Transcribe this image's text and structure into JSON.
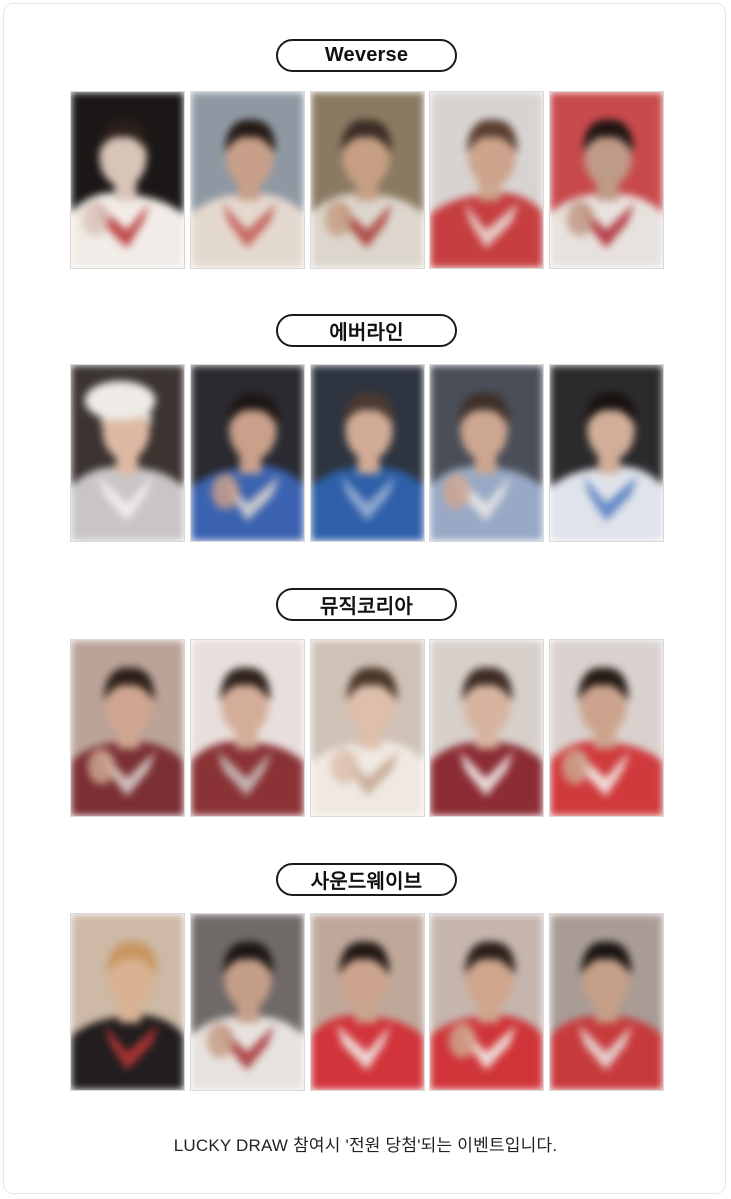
{
  "sections": [
    {
      "label": "Weverse",
      "cards": [
        {
          "bg": "#1a1716",
          "skin": "#d9c4b8",
          "top": "#f1ece7",
          "accent": "#b83a3c",
          "hair": "#2a1f1a",
          "hat": ""
        },
        {
          "bg": "#8f98a2",
          "skin": "#c8a08a",
          "top": "#e4d9cf",
          "accent": "#c15d55",
          "hair": "#231a16",
          "hat": ""
        },
        {
          "bg": "#8a7a62",
          "skin": "#c69f84",
          "top": "#dcd6cc",
          "accent": "#a8403c",
          "hair": "#3a2c24",
          "hat": ""
        },
        {
          "bg": "#d7d3d1",
          "skin": "#cda48c",
          "top": "#c63e40",
          "accent": "#ead9d4",
          "hair": "#5a3e30",
          "hat": ""
        },
        {
          "bg": "#c84a4c",
          "skin": "#bf9a86",
          "top": "#e8e2de",
          "accent": "#b0303a",
          "hair": "#1e1614",
          "hat": ""
        }
      ]
    },
    {
      "label": "에버라인",
      "cards": [
        {
          "bg": "#3b3430",
          "skin": "#ddb9a4",
          "top": "#c9c4c6",
          "accent": "#f2efec",
          "hair": "#e9e6e3",
          "hat": "#eeeae6"
        },
        {
          "bg": "#2a2a30",
          "skin": "#c9a08a",
          "top": "#3b62b0",
          "accent": "#d8d3d0",
          "hair": "#1d1714",
          "hat": ""
        },
        {
          "bg": "#2e3440",
          "skin": "#d1ab95",
          "top": "#2e5fa8",
          "accent": "#9ab0d4",
          "hair": "#4a3a32",
          "hat": ""
        },
        {
          "bg": "#4a4e58",
          "skin": "#cda690",
          "top": "#98a9c6",
          "accent": "#e9e6e6",
          "hair": "#3e3028",
          "hat": ""
        },
        {
          "bg": "#2b2a2c",
          "skin": "#d2ae98",
          "top": "#dfe3ea",
          "accent": "#5a7fc2",
          "hair": "#17120f",
          "hat": ""
        }
      ]
    },
    {
      "label": "뮤직코리아",
      "cards": [
        {
          "bg": "#bba398",
          "skin": "#cfa690",
          "top": "#7a2f34",
          "accent": "#d9cfcb",
          "hair": "#2a1e18",
          "hat": ""
        },
        {
          "bg": "#e8dedb",
          "skin": "#d3ad98",
          "top": "#8a3236",
          "accent": "#c9c0bd",
          "hair": "#2e221c",
          "hat": ""
        },
        {
          "bg": "#cfc1b6",
          "skin": "#ddbfac",
          "top": "#efe9e2",
          "accent": "#c7a893",
          "hair": "#4a3628",
          "hat": ""
        },
        {
          "bg": "#d7cfca",
          "skin": "#d6b4a0",
          "top": "#8c2c34",
          "accent": "#f1ede9",
          "hair": "#3c2b22",
          "hat": ""
        },
        {
          "bg": "#d9d1cd",
          "skin": "#cca48e",
          "top": "#d03a3c",
          "accent": "#f3eeea",
          "hair": "#241a15",
          "hat": ""
        }
      ]
    },
    {
      "label": "사운드웨이브",
      "cards": [
        {
          "bg": "#cdb9a6",
          "skin": "#d8b293",
          "top": "#221d1e",
          "accent": "#b73636",
          "hair": "#c89660",
          "hat": ""
        },
        {
          "bg": "#6f6a68",
          "skin": "#c59e89",
          "top": "#e7e2de",
          "accent": "#a83a3a",
          "hair": "#1c1613",
          "hat": ""
        },
        {
          "bg": "#bfa89a",
          "skin": "#cca48d",
          "top": "#d1343a",
          "accent": "#f0e8e4",
          "hair": "#221814",
          "hat": ""
        },
        {
          "bg": "#c5b5ad",
          "skin": "#cfa58c",
          "top": "#cf3438",
          "accent": "#f2ebe6",
          "hair": "#2a1e18",
          "hat": ""
        },
        {
          "bg": "#a99c95",
          "skin": "#c59f88",
          "top": "#c73a3c",
          "accent": "#e8e0dc",
          "hair": "#1b1512",
          "hat": ""
        }
      ]
    }
  ],
  "footer": "LUCKY DRAW 참여시 '전원 당첨'되는 이벤트입니다."
}
